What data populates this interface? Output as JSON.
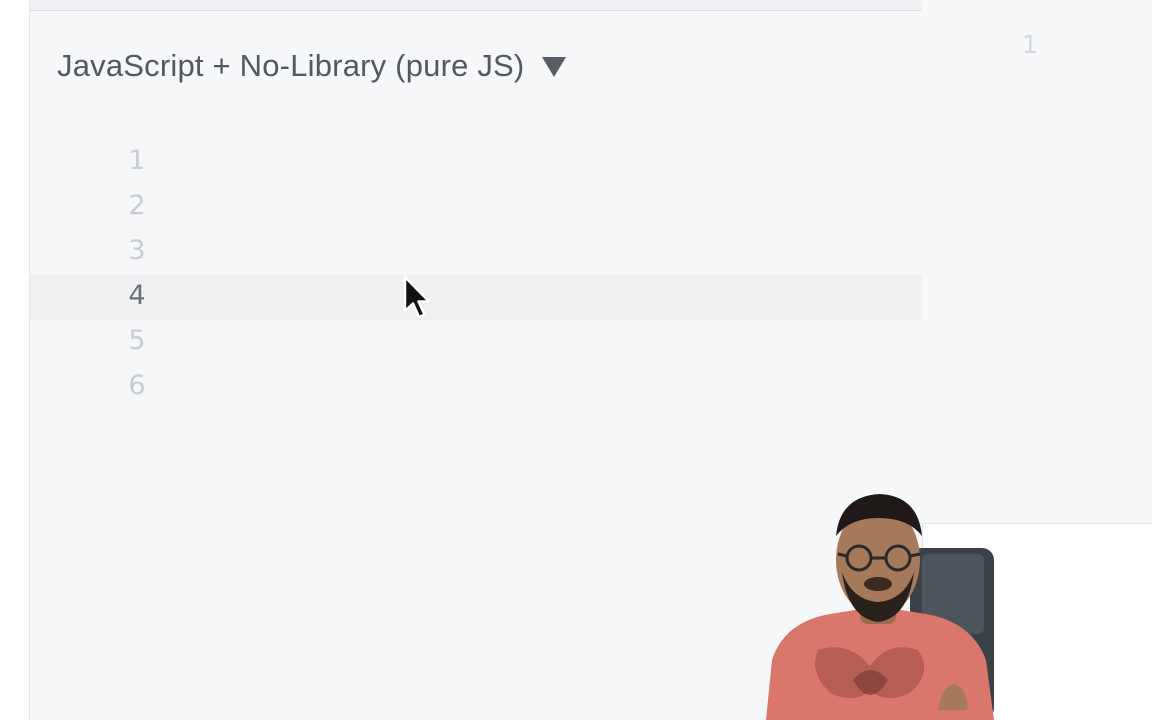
{
  "editor": {
    "language_label": "JavaScript + No-Library (pure JS)",
    "dropdown_icon": "triangle-down",
    "line_numbers": [
      "1",
      "2",
      "3",
      "4",
      "5",
      "6"
    ],
    "active_line": "4"
  },
  "output": {
    "line_number": "1"
  },
  "presenter": {
    "shirt_color": "#d9776d"
  }
}
